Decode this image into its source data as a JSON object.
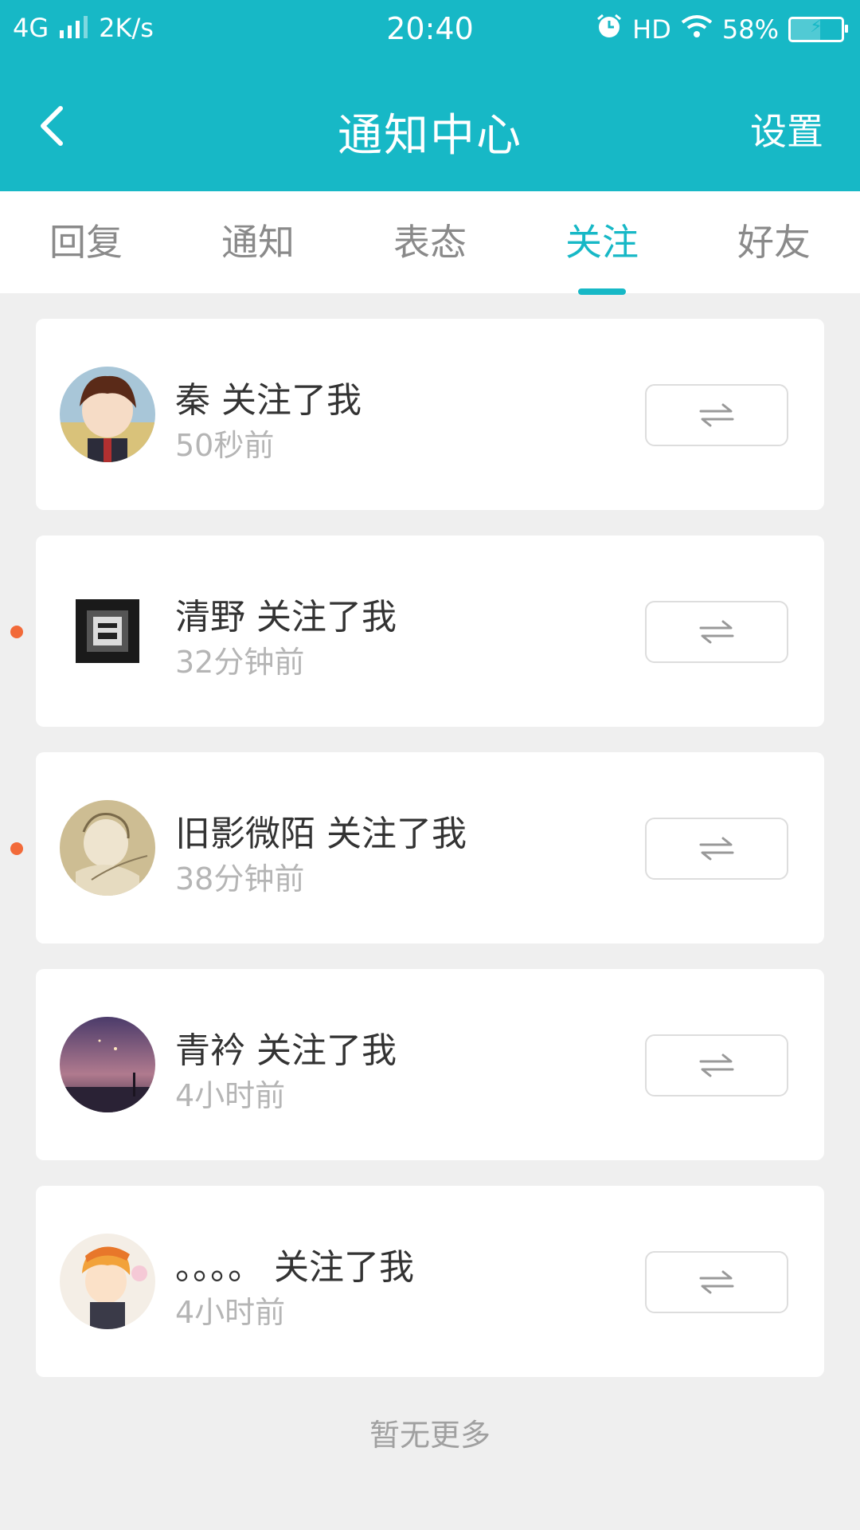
{
  "status_bar": {
    "network": "4G",
    "speed": "2K/s",
    "time": "20:40",
    "hd": "HD",
    "battery": "58%",
    "battery_level": 0.58
  },
  "header": {
    "title": "通知中心",
    "settings_label": "设置"
  },
  "tabs": [
    {
      "label": "回复",
      "active": false
    },
    {
      "label": "通知",
      "active": false
    },
    {
      "label": "表态",
      "active": false
    },
    {
      "label": "关注",
      "active": true
    },
    {
      "label": "好友",
      "active": false
    }
  ],
  "items": [
    {
      "name": "秦 关注了我",
      "time": "50秒前",
      "unread": false
    },
    {
      "name": "清野 关注了我",
      "time": "32分钟前",
      "unread": true
    },
    {
      "name": "旧影微陌 关注了我",
      "time": "38分钟前",
      "unread": true
    },
    {
      "name": "青衿 关注了我",
      "time": "4小时前",
      "unread": false
    },
    {
      "name": "。。。。 关注了我",
      "time": "4小时前",
      "unread": false
    }
  ],
  "footer": {
    "no_more": "暂无更多"
  },
  "colors": {
    "accent": "#17b8c6",
    "unread_dot": "#f26a39"
  }
}
